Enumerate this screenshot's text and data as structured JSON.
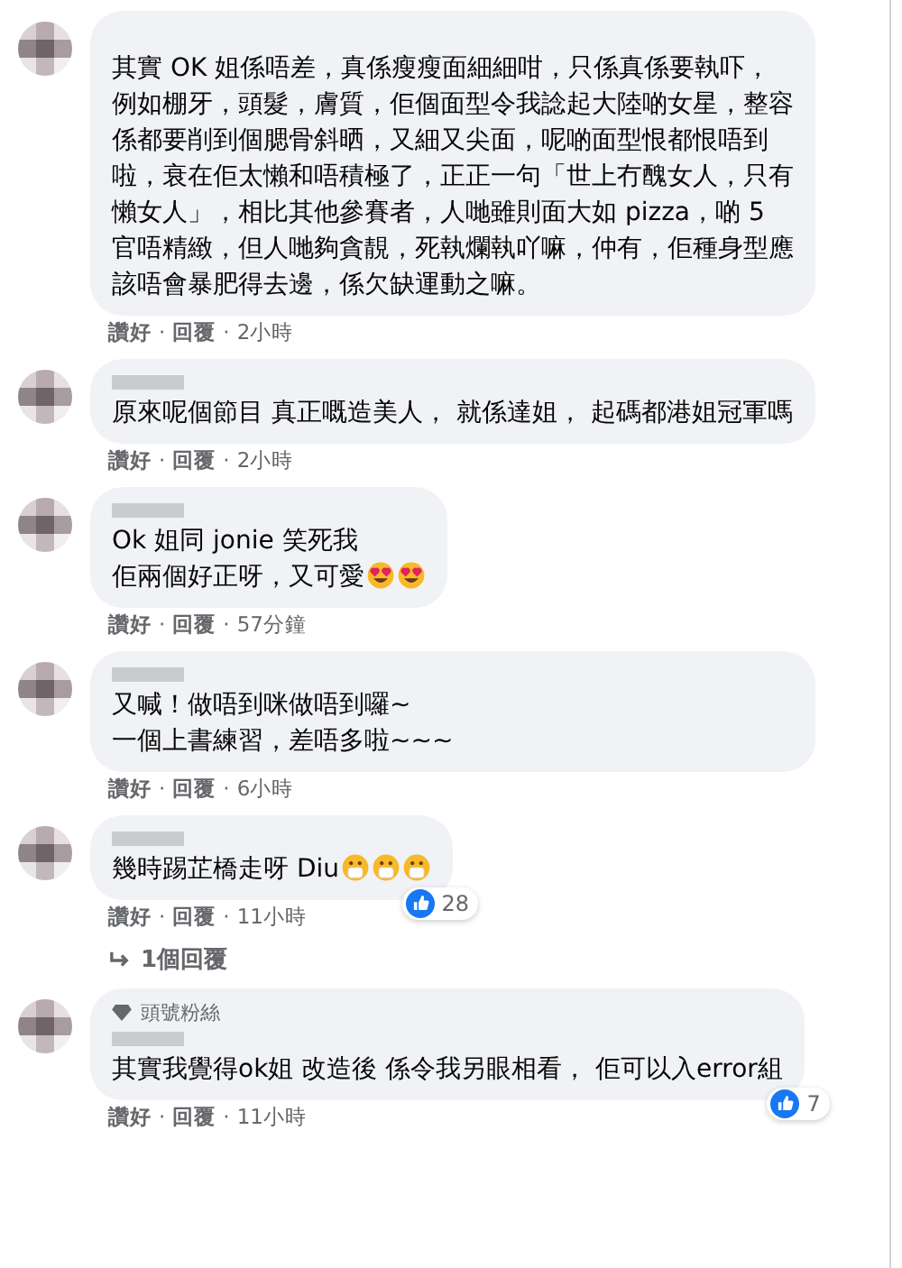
{
  "separator": "·",
  "comments": [
    {
      "name_visible": false,
      "lines": [
        "其實 OK 姐係唔差，真係瘦瘦面細細咁，只係真係要執吓，例如棚牙，頭髮，膚質，佢個面型令我諗起大陸啲女星，整容係都要削到個腮骨斜晒，又細又尖面，呢啲面型恨都恨唔到啦，衰在佢太懶和唔積極了，正正一句「世上冇醜女人，只有懶女人」，相比其他參賽者，人哋雖則面大如 pizza，啲 5 官唔精緻，但人哋夠貪靚，死執爛執吖嘛，仲有，佢種身型應該唔會暴肥得去邊，係欠缺運動之嘛。"
      ],
      "actions": [
        "讚好",
        "回覆",
        "2小時"
      ]
    },
    {
      "name_visible": true,
      "lines": [
        "原來呢個節目 真正嘅造美人， 就係達姐， 起碼都港姐冠軍嗎"
      ],
      "actions": [
        "讚好",
        "回覆",
        "2小時"
      ]
    },
    {
      "name_visible": true,
      "lines": [
        "Ok 姐同 jonie 笑死我",
        "佢兩個好正呀，又可愛"
      ],
      "emoji": [
        {
          "kind": "heart_eyes"
        },
        {
          "kind": "heart_eyes"
        }
      ],
      "actions": [
        "讚好",
        "回覆",
        "57分鐘"
      ]
    },
    {
      "name_visible": true,
      "lines": [
        "又喊！做唔到咪做唔到囉~",
        "一個上書練習，差唔多啦~~~"
      ],
      "actions": [
        "讚好",
        "回覆",
        "6小時"
      ]
    },
    {
      "name_visible": true,
      "lines": [
        "幾時踢芷橋走呀 Diu"
      ],
      "emoji": [
        {
          "kind": "mask"
        },
        {
          "kind": "mask"
        },
        {
          "kind": "mask"
        }
      ],
      "actions": [
        "讚好",
        "回覆",
        "11小時"
      ],
      "likes": "28",
      "replies": "1個回覆"
    },
    {
      "name_visible": true,
      "badge": "頭號粉絲",
      "lines": [
        "其實我覺得ok姐 改造後 係令我另眼相看， 佢可以入error組"
      ],
      "actions": [
        "讚好",
        "回覆",
        "11小時"
      ],
      "likes": "7"
    }
  ]
}
